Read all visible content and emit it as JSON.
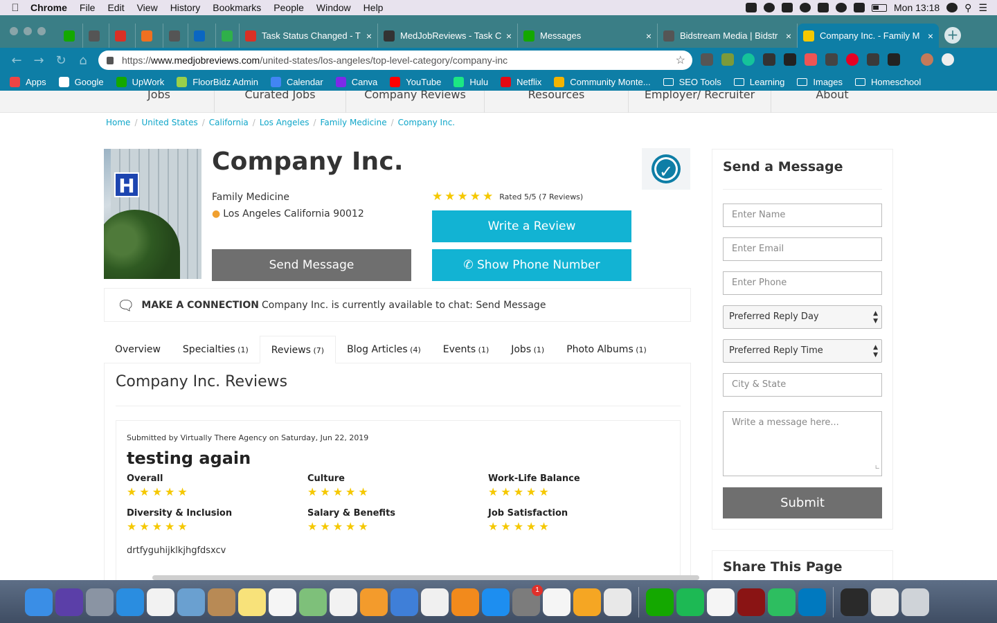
{
  "menubar": {
    "items": [
      "Chrome",
      "File",
      "Edit",
      "View",
      "History",
      "Bookmarks",
      "People",
      "Window",
      "Help"
    ],
    "clock": "Mon 13:18"
  },
  "tabs": [
    {
      "label": "",
      "icon": "upwork-icon",
      "color": "#14a800"
    },
    {
      "label": "",
      "icon": "globe-icon",
      "color": "#555"
    },
    {
      "label": "",
      "icon": "gmail-icon",
      "color": "#d93025"
    },
    {
      "label": "",
      "icon": "floorbidz-icon",
      "color": "#f07020"
    },
    {
      "label": "",
      "icon": "globe-icon",
      "color": "#555"
    },
    {
      "label": "",
      "icon": "linkedin-icon",
      "color": "#0a66c2"
    },
    {
      "label": "",
      "icon": "px-icon",
      "color": "#2fb04a"
    },
    {
      "label": "Task Status Changed - T",
      "icon": "gmail-icon",
      "color": "#d93025"
    },
    {
      "label": "MedJobReviews - Task C",
      "icon": "bl-icon",
      "color": "#333"
    },
    {
      "label": "Messages",
      "icon": "upwork-icon",
      "color": "#14a800"
    },
    {
      "label": "Bidstream Media | Bidstr",
      "icon": "globe-icon",
      "color": "#555"
    },
    {
      "label": "Company Inc. - Family M",
      "icon": "bulb-icon",
      "color": "#f5c800"
    }
  ],
  "address": {
    "scheme": "https://",
    "host": "www.medjobreviews.com",
    "path": "/united-states/los-angeles/top-level-category/company-inc"
  },
  "bookmarks": [
    {
      "label": "Apps",
      "color": "#e44"
    },
    {
      "label": "Google",
      "color": "#fff"
    },
    {
      "label": "UpWork",
      "color": "#14a800"
    },
    {
      "label": "FloorBidz Admin",
      "color": "#9ad04a"
    },
    {
      "label": "Calendar",
      "color": "#4285f4"
    },
    {
      "label": "Canva",
      "color": "#7d2ae8"
    },
    {
      "label": "YouTube",
      "color": "#ff0000"
    },
    {
      "label": "Hulu",
      "color": "#1ce783"
    },
    {
      "label": "Netflix",
      "color": "#e50914"
    },
    {
      "label": "Community Monte...",
      "color": "#f4b400"
    },
    {
      "label": "SEO Tools",
      "folder": true
    },
    {
      "label": "Learning",
      "folder": true
    },
    {
      "label": "Images",
      "folder": true
    },
    {
      "label": "Homeschool",
      "folder": true
    }
  ],
  "topnav": [
    "Jobs",
    "Curated Jobs",
    "Company Reviews",
    "Resources",
    "Employer/ Recruiter",
    "About"
  ],
  "breadcrumb": [
    "Home",
    "United States",
    "California",
    "Los Angeles",
    "Family Medicine",
    "Company Inc."
  ],
  "company": {
    "name": "Company Inc.",
    "category": "Family Medicine",
    "location": "Los Angeles California 90012",
    "rating_text": "Rated 5/5 (7 Reviews)",
    "rating": 5
  },
  "buttons": {
    "write_review": "Write a Review",
    "show_phone": "Show Phone Number",
    "send_message": "Send Message"
  },
  "connect": {
    "label": "MAKE A CONNECTION",
    "text": "Company Inc. is currently available to chat:",
    "link": "Send Message"
  },
  "profile_tabs": [
    {
      "label": "Overview",
      "count": ""
    },
    {
      "label": "Specialties",
      "count": "(1)"
    },
    {
      "label": "Reviews",
      "count": "(7)"
    },
    {
      "label": "Blog Articles",
      "count": "(4)"
    },
    {
      "label": "Events",
      "count": "(1)"
    },
    {
      "label": "Jobs",
      "count": "(1)"
    },
    {
      "label": "Photo Albums",
      "count": "(1)"
    }
  ],
  "reviews": {
    "heading": "Company Inc. Reviews",
    "item": {
      "meta": "Submitted by Virtually There Agency on Saturday, Jun 22, 2019",
      "title": "testing again",
      "criteria": [
        {
          "label": "Overall",
          "stars": 5
        },
        {
          "label": "Culture",
          "stars": 5
        },
        {
          "label": "Work-Life Balance",
          "stars": 5
        },
        {
          "label": "Diversity & Inclusion",
          "stars": 5
        },
        {
          "label": "Salary & Benefits",
          "stars": 5
        },
        {
          "label": "Job Satisfaction",
          "stars": 5
        }
      ],
      "body": "drtfyguhijklkjhgfdsxcv"
    }
  },
  "message_form": {
    "heading": "Send a Message",
    "name_placeholder": "Enter Name",
    "email_placeholder": "Enter Email",
    "phone_placeholder": "Enter Phone",
    "reply_day": "Preferred Reply Day",
    "reply_time": "Preferred Reply Time",
    "city_placeholder": "City & State",
    "message_placeholder": "Write a message here...",
    "submit": "Submit"
  },
  "share": {
    "heading": "Share This Page"
  },
  "dock": {
    "badge": "1",
    "apps": [
      {
        "icon": "finder-icon",
        "color": "#3a8ee6"
      },
      {
        "icon": "siri-icon",
        "color": "#5b3fa8"
      },
      {
        "icon": "launchpad-icon",
        "color": "#8a94a3"
      },
      {
        "icon": "safari-icon",
        "color": "#2a8de0"
      },
      {
        "icon": "grid-icon",
        "color": "#f2f2f2"
      },
      {
        "icon": "preview-icon",
        "color": "#6aa0d0"
      },
      {
        "icon": "contacts-icon",
        "color": "#b88a55"
      },
      {
        "icon": "notes-icon",
        "color": "#f8e27a"
      },
      {
        "icon": "reminders-icon",
        "color": "#f5f5f5"
      },
      {
        "icon": "maps-icon",
        "color": "#7ec07a"
      },
      {
        "icon": "photos-icon",
        "color": "#f2f2f2"
      },
      {
        "icon": "pages-icon",
        "color": "#f39b2c"
      },
      {
        "icon": "keynote-icon",
        "color": "#3f7fd8"
      },
      {
        "icon": "itunes-icon",
        "color": "#f0f0f0"
      },
      {
        "icon": "books-icon",
        "color": "#f28a1c"
      },
      {
        "icon": "appstore-icon",
        "color": "#1d8ef0"
      },
      {
        "icon": "settings-icon",
        "color": "#7c7c7c",
        "badge": true
      },
      {
        "icon": "numbers-icon",
        "color": "#f5f5f5"
      },
      {
        "icon": "messages-icon",
        "color": "#f5a623"
      },
      {
        "icon": "chrome-icon",
        "color": "#e8e8e8"
      },
      {
        "sep": true
      },
      {
        "icon": "upwork-icon",
        "color": "#14a800"
      },
      {
        "icon": "spotify-icon",
        "color": "#1db954"
      },
      {
        "icon": "face-icon",
        "color": "#f5f5f5"
      },
      {
        "icon": "acrobat-icon",
        "color": "#8a1414"
      },
      {
        "icon": "evernote-icon",
        "color": "#2dbe60"
      },
      {
        "icon": "trello-icon",
        "color": "#0079bf"
      },
      {
        "sep": true
      },
      {
        "icon": "window-thumb-icon",
        "color": "#2a2a2a"
      },
      {
        "icon": "document-thumb-icon",
        "color": "#e8e8e8"
      },
      {
        "icon": "trash-icon",
        "color": "#cfd3d8"
      }
    ]
  }
}
